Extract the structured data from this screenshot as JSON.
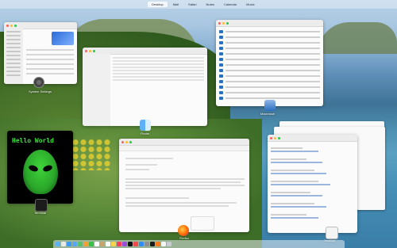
{
  "mission_control": {
    "spaces": [
      "Desktop",
      "Mail",
      "Safari",
      "Notes",
      "Calendar",
      "Music"
    ],
    "active_space": "Desktop"
  },
  "windows": {
    "settings": {
      "label": "System Settings"
    },
    "finder": {
      "label": "Finder"
    },
    "list": {
      "label": "Macintosh"
    },
    "terminal": {
      "label": "Terminal",
      "banner": "Hello World"
    },
    "mail": {
      "label": "Firefox",
      "greeting": "Hi there,"
    },
    "editor": {
      "label": "TextEdit"
    }
  },
  "colors": {
    "accent": "#2b6fbf",
    "terminal_green": "#39e23a"
  },
  "dock": {
    "icons": [
      "finder-icon",
      "launchpad-icon",
      "safari-icon",
      "mail-icon",
      "maps-icon",
      "photos-icon",
      "facetime-icon",
      "calendar-icon",
      "contacts-icon",
      "reminders-icon",
      "notes-icon",
      "music-icon",
      "podcasts-icon",
      "tv-icon",
      "news-icon",
      "appstore-icon",
      "settings-icon",
      "terminal-icon",
      "firefox-icon",
      "textedit-icon",
      "trash-icon"
    ]
  }
}
